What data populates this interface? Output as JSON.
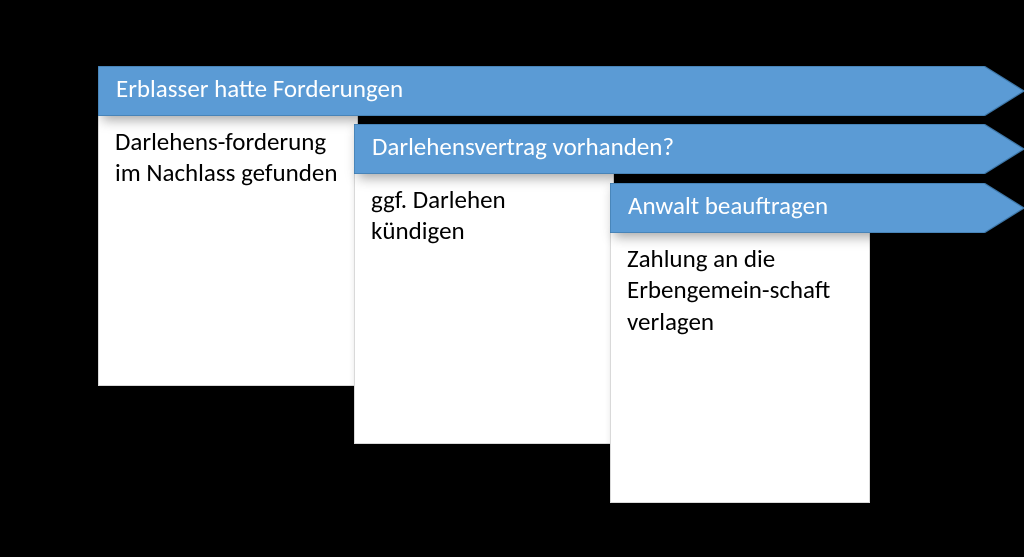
{
  "colors": {
    "arrow_fill": "#5B9BD5",
    "arrow_stroke": "#3E77A8"
  },
  "steps": [
    {
      "title": "Erblasser hatte Forderungen",
      "body": "Darlehens-forderung im Nachlass gefunden"
    },
    {
      "title": "Darlehensvertrag vorhanden?",
      "body": "ggf. Darlehen kündigen"
    },
    {
      "title": "Anwalt beauftragen",
      "body": "Zahlung an die Erbengemein-schaft verlagen"
    }
  ]
}
